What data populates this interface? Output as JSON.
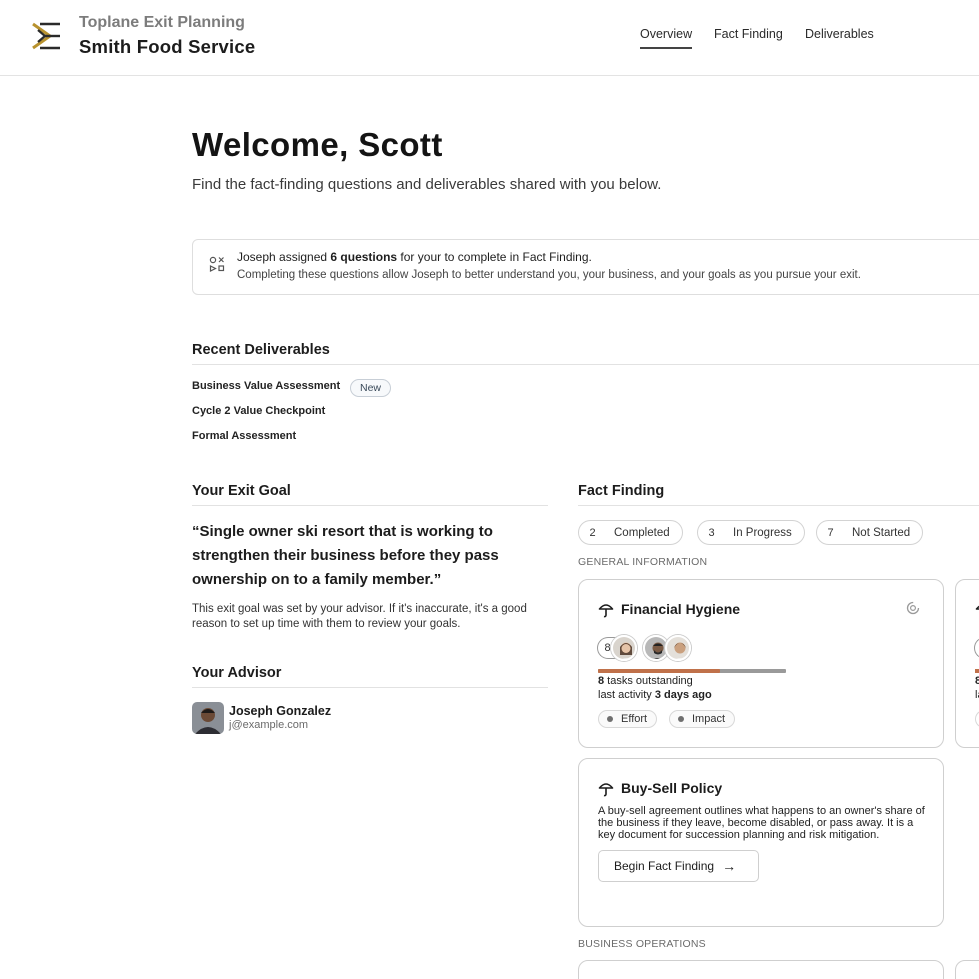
{
  "header": {
    "brand_top": "Toplane Exit Planning",
    "brand_bottom": "Smith Food Service",
    "nav": [
      "Overview",
      "Fact Finding",
      "Deliverables"
    ],
    "logo_icon": "toplane-logo-icon"
  },
  "welcome": {
    "title": "Welcome, Scott",
    "subtitle": "Find the fact-finding questions and deliverables shared with you below."
  },
  "banner": {
    "icon": "shapes-icon",
    "line1_prefix": "Joseph assigned ",
    "line1_bold": "6 questions",
    "line1_suffix": " for your to complete in Fact Finding.",
    "line2": "Completing these questions allow Joseph to better understand you, your business, and your goals as you pursue your exit."
  },
  "recent_deliverables": {
    "title": "Recent Deliverables",
    "items": [
      {
        "label": "Business Value Assessment",
        "badge": "New"
      },
      {
        "label": "Cycle 2 Value Checkpoint"
      },
      {
        "label": "Formal Assessment"
      }
    ]
  },
  "exit_goal": {
    "title": "Your Exit Goal",
    "quote": "“Single owner ski resort that is working to strengthen their business before they pass ownership on to a family member.”",
    "note": "This exit goal was set by your advisor. If it's inaccurate, it's a good reason to set up time with them to review your goals."
  },
  "advisor": {
    "title": "Your Advisor",
    "name": "Joseph Gonzalez",
    "email": "j@example.com"
  },
  "fact_finding": {
    "title": "Fact Finding",
    "chips": [
      {
        "count": "2",
        "label": "Completed"
      },
      {
        "count": "3",
        "label": "In Progress"
      },
      {
        "count": "7",
        "label": "Not Started"
      }
    ],
    "group1": "GENERAL INFORMATION",
    "group2": "BUSINESS OPERATIONS",
    "cards": {
      "financial_hygiene": {
        "title": "Financial Hygiene",
        "icon": "umbrella-icon",
        "status_icon": "progress-ring-icon",
        "avatar_count": "8",
        "progress": 0.65,
        "tasks_bold": "8",
        "tasks_rest": " tasks outstanding",
        "activity_prefix": "last activity ",
        "activity_bold": "3 days ago",
        "tags": [
          "Effort",
          "Impact"
        ]
      },
      "buy_sell": {
        "title": "Buy-Sell Policy",
        "icon": "umbrella-icon",
        "description": "A buy-sell agreement outlines what happens to an owner's share of the business if they leave, become disabled, or pass away. It is a key document for succession planning and risk mitigation.",
        "button": "Begin Fact Finding",
        "button_icon": "arrow-right-icon"
      },
      "partial_card": {
        "avatar_count_partial": "8",
        "line1": "8",
        "line2": "la"
      }
    }
  },
  "colors": {
    "accent_gold": "#b8922e",
    "progress": "#c0714a",
    "border": "#cfcfcf"
  }
}
